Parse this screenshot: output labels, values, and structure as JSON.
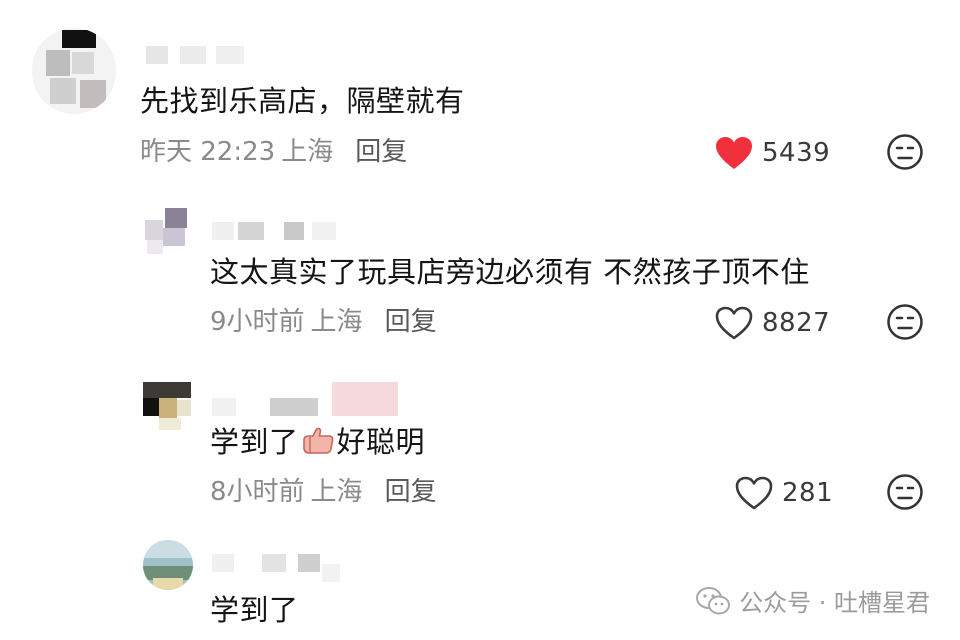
{
  "comments": [
    {
      "text": "先找到乐高店，隔壁就有",
      "time": "昨天 22:23",
      "location": "上海",
      "reply_label": "回复",
      "likes": "5439",
      "liked": true
    },
    {
      "text": "这太真实了玩具店旁边必须有 不然孩子顶不住",
      "time": "9小时前",
      "location": "上海",
      "reply_label": "回复",
      "likes": "8827",
      "liked": false
    },
    {
      "text_before": "学到了",
      "text_emoji": "thumbs-up-emoji",
      "text_after": "好聪明",
      "time": "8小时前",
      "location": "上海",
      "reply_label": "回复",
      "likes": "281",
      "liked": false
    },
    {
      "text": "学到了"
    }
  ],
  "watermark": {
    "text": "公众号 · 吐槽星君",
    "icon": "wechat-icon"
  },
  "icons": {
    "like": "heart-icon",
    "dislike": "unamused-face-icon"
  },
  "colors": {
    "like_active": "#f0303c",
    "meta_gray": "#8a8a8a",
    "text": "#151515"
  }
}
